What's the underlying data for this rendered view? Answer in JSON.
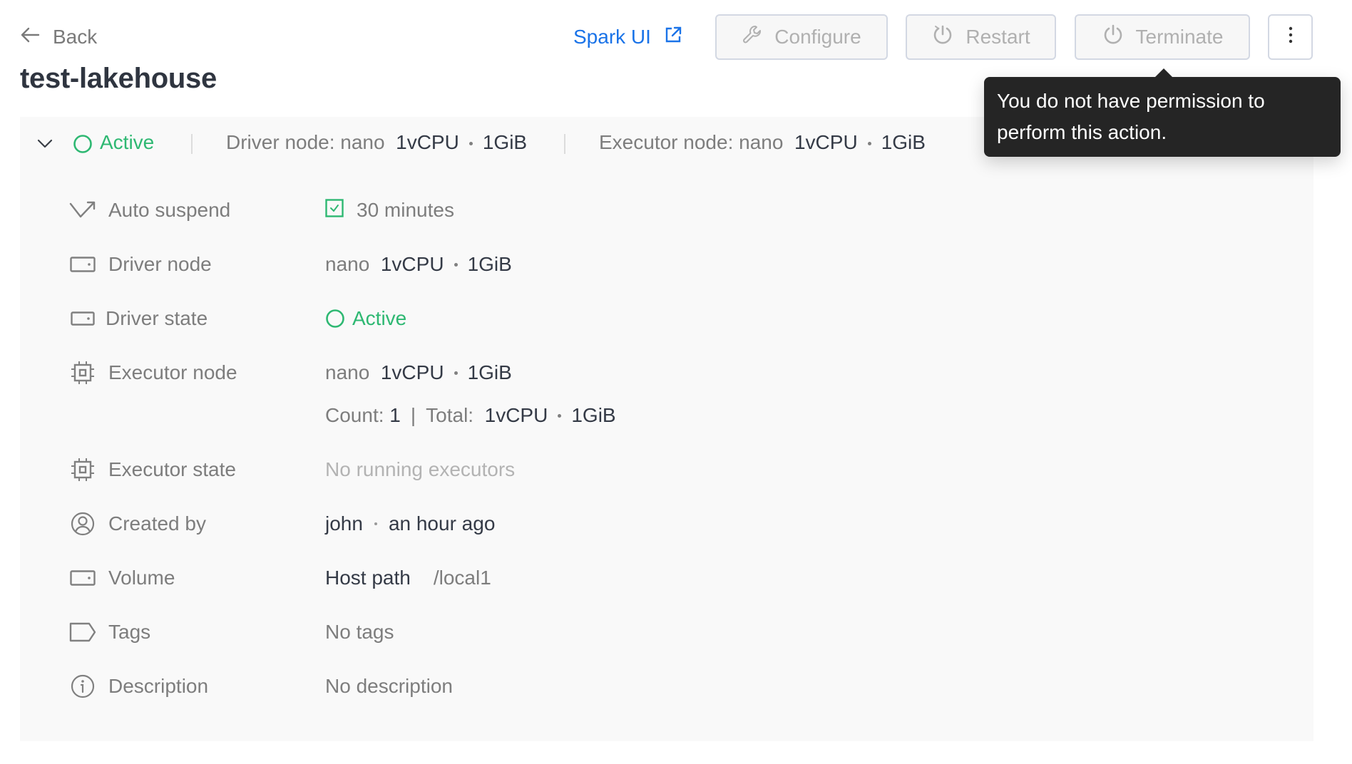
{
  "nav": {
    "back_label": "Back",
    "back_icon": "arrow-left-icon"
  },
  "page": {
    "title": "test-lakehouse"
  },
  "toolbar": {
    "spark_ui_label": "Spark UI",
    "spark_ui_icon": "external-link-icon",
    "configure_label": "Configure",
    "restart_label": "Restart",
    "terminate_label": "Terminate",
    "more_icon": "more-vertical-icon"
  },
  "tooltip": {
    "text": "You do not have permission to perform this action."
  },
  "summary": {
    "status": "Active",
    "driver_label": "Driver node: nano",
    "driver_cpu": "1vCPU",
    "driver_mem": "1GiB",
    "executor_label": "Executor node: nano",
    "executor_cpu": "1vCPU",
    "executor_mem": "1GiB"
  },
  "details": {
    "auto_suspend": {
      "label": "Auto suspend",
      "enabled": true,
      "value": "30 minutes"
    },
    "driver_node": {
      "label": "Driver node",
      "size": "nano",
      "cpu": "1vCPU",
      "mem": "1GiB"
    },
    "driver_state": {
      "label": "Driver state",
      "value": "Active"
    },
    "executor_node": {
      "label": "Executor node",
      "size": "nano",
      "cpu": "1vCPU",
      "mem": "1GiB",
      "count_label": "Count:",
      "count": "1",
      "total_label": "Total:",
      "total_cpu": "1vCPU",
      "total_mem": "1GiB"
    },
    "executor_state": {
      "label": "Executor state",
      "value": "No running executors"
    },
    "created_by": {
      "label": "Created by",
      "user": "john",
      "time": "an hour ago"
    },
    "volume": {
      "label": "Volume",
      "type": "Host path",
      "path": "/local1"
    },
    "tags": {
      "label": "Tags",
      "value": "No tags"
    },
    "description": {
      "label": "Description",
      "value": "No description"
    }
  },
  "colors": {
    "accent": "#1a73e8",
    "success": "#2eb872",
    "tooltip_bg": "#252525",
    "panel_bg": "#f9f9f9"
  }
}
